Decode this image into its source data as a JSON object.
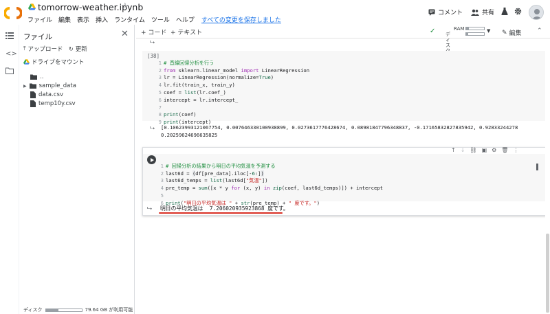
{
  "app": {
    "title": "tomorrow-weather.ipynb",
    "menu": [
      "ファイル",
      "編集",
      "表示",
      "挿入",
      "ランタイム",
      "ツール",
      "ヘルプ"
    ],
    "saved_status": "すべての変更を保存しました",
    "comment_label": "コメント",
    "share_label": "共有"
  },
  "toolbar": {
    "add_code": "+ コード",
    "add_text": "+ テキスト",
    "ram_label": "RAM",
    "disk_label": "ディスク",
    "ram_usage": 0.15,
    "disk_usage": 0.1,
    "edit_label": "編集"
  },
  "sidebar": {
    "title": "ファイル",
    "upload": "アップロード",
    "refresh": "更新",
    "mount_drive": "ドライブをマウント",
    "tree": [
      "..",
      "sample_data",
      "data.csv",
      "temp10y.csv"
    ],
    "disk_label": "ディスク",
    "disk_free": "79.64 GB が利用可能",
    "disk_usage": 0.35
  },
  "cells": {
    "cell1_count": "[38]",
    "cell1_lines": [
      "# 直線回帰分析を行う",
      "from sklearn.linear_model import LinearRegression",
      "lr = LinearRegression(normalize=True)",
      "lr.fit(train_x, train_y)",
      "coef = list(lr.coef_)",
      "intercept = lr.intercept_",
      "",
      "print(coef)",
      "print(intercept)"
    ],
    "cell1_output_1": "[0.10623993121067754, 0.007646330100938899, 0.0273617776428674, 0.08981847796348837, -0.17165832827835942, 0.92833244278",
    "cell1_output_2": "0.20259624696635825",
    "cell2_lines": [
      "# 回帰分析の結果から明日の平均気温を予測する",
      "last6d = (df[pre_data].iloc[-6:])",
      "last6d_temps = list(last6d[\"気温\"])",
      "pre_temp = sum([x * y for (x, y) in zip(coef, last6d_temps)]) + intercept",
      "",
      "print(\"明日の平均気温は \" + str(pre_temp) + \" 度です。\")"
    ],
    "cell2_output": "明日の平均気温は  7.206020935923868 度です。"
  },
  "colors": {
    "accent": "#1a73e8",
    "underline": "#d93025",
    "logo_orange": "#f9ab00",
    "logo_dark": "#e8710a"
  }
}
